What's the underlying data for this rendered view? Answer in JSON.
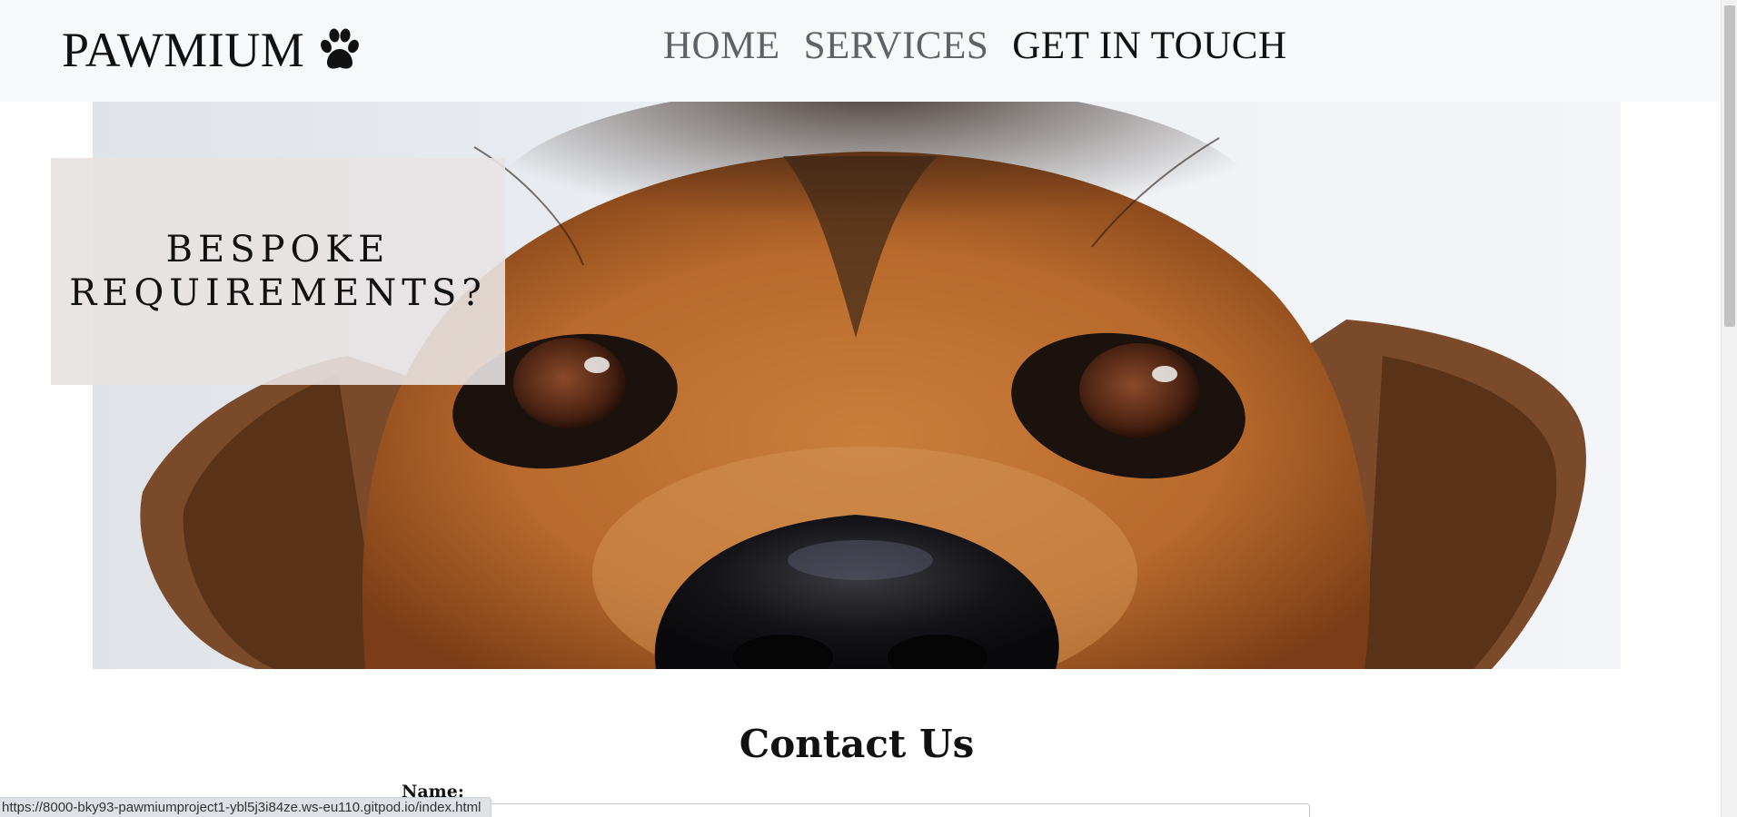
{
  "brand": {
    "name": "PAWMIUM",
    "icon": "paw-icon"
  },
  "nav": {
    "items": [
      {
        "label": "HOME",
        "active": false
      },
      {
        "label": "SERVICES",
        "active": false
      },
      {
        "label": "GET IN TOUCH",
        "active": true
      }
    ]
  },
  "hero": {
    "image": "dog-face-closeup",
    "callout": "BESPOKE\nREQUIREMENTS?"
  },
  "contact": {
    "title": "Contact Us",
    "name_label": "Name:",
    "name_value": ""
  },
  "status_bar": {
    "url": "https://8000-bky93-pawmiumproject1-ybl5j3i84ze.ws-eu110.gitpod.io/index.html"
  },
  "colors": {
    "navbar_bg": "#f7f8f9",
    "nav_inactive": "#5f6166",
    "nav_active": "#111111",
    "callout_bg": "#e8e2e2"
  }
}
